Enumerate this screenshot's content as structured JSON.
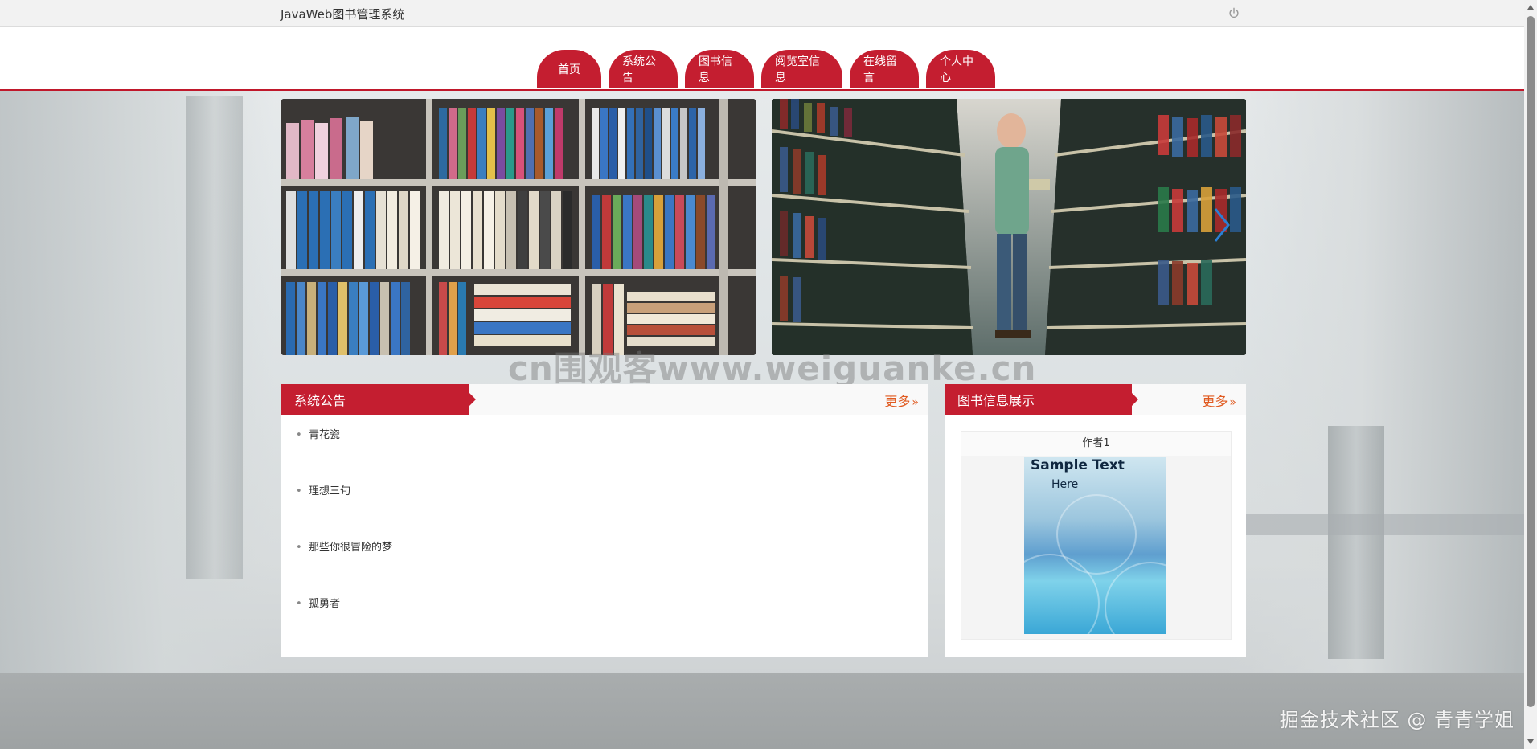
{
  "app": {
    "title": "JavaWeb图书管理系统"
  },
  "icons": {
    "power": "power-icon",
    "next": "chevron-right-icon",
    "more": "double-chevron-right-icon"
  },
  "nav": {
    "items": [
      {
        "label": "首页"
      },
      {
        "label": "系统公告"
      },
      {
        "label": "图书信息"
      },
      {
        "label": "阅览室信息"
      },
      {
        "label": "在线留言"
      },
      {
        "label": "个人中心"
      }
    ]
  },
  "watermark": "cn围观客www.weiguanke.cn",
  "notice_panel": {
    "title": "系统公告",
    "more": "更多",
    "items": [
      "青花瓷",
      "理想三旬",
      "那些你很冒险的梦",
      "孤勇者"
    ]
  },
  "books_panel": {
    "title": "图书信息展示",
    "more": "更多",
    "book": {
      "author": "作者1",
      "cover_line1": "Sample Text",
      "cover_line2": "Here"
    }
  },
  "footer": {
    "text": "掘金技术社区 @ 青青学姐"
  },
  "colors": {
    "accent": "#c41e30",
    "more_link": "#e05a20"
  }
}
